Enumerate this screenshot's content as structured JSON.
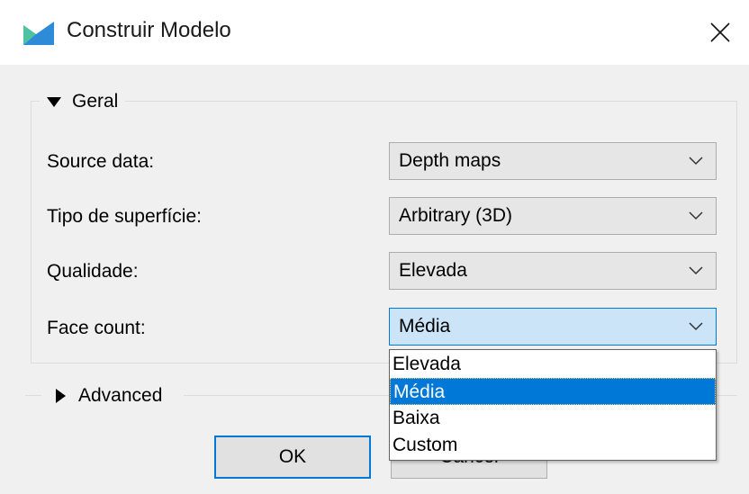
{
  "window": {
    "title": "Construir Modelo",
    "icon": "app-icon",
    "close_glyph": "✕"
  },
  "general": {
    "header": "Geral",
    "rows": [
      {
        "label": "Source data:",
        "value": "Depth maps"
      },
      {
        "label": "Tipo de superfície:",
        "value": "Arbitrary (3D)"
      },
      {
        "label": "Qualidade:",
        "value": "Elevada"
      },
      {
        "label": "Face count:",
        "value": "Média"
      }
    ]
  },
  "face_count_dropdown": {
    "options": [
      "Elevada",
      "Média",
      "Baixa",
      "Custom"
    ],
    "selected": "Média"
  },
  "advanced": {
    "header": "Advanced"
  },
  "buttons": {
    "ok": "OK",
    "cancel": "Cancel"
  },
  "colors": {
    "accent": "#0078d7",
    "combo_active_bg": "#cce4f7",
    "dialog_bg": "#f0f0f0"
  }
}
